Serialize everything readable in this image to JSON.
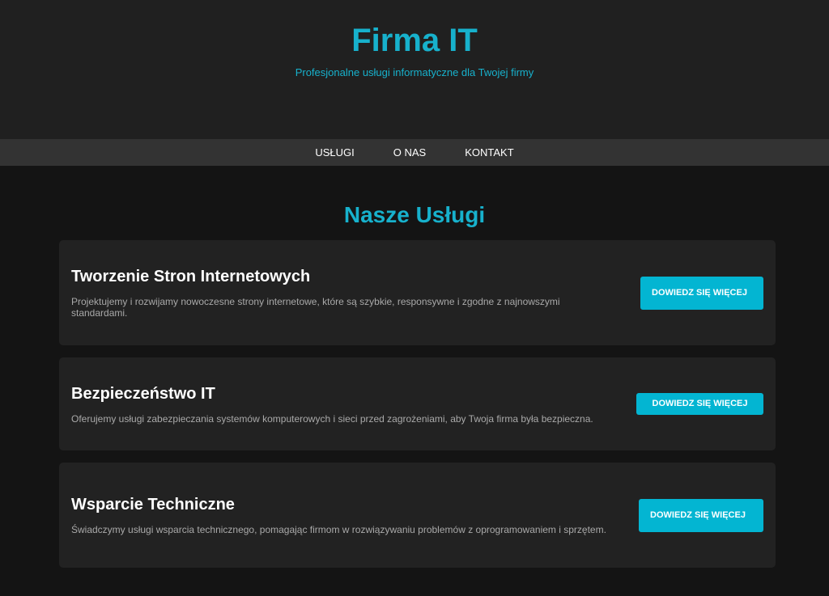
{
  "header": {
    "title": "Firma IT",
    "tagline": "Profesjonalne usługi informatyczne dla Twojej firmy"
  },
  "nav": {
    "items": [
      {
        "label": "USŁUGI"
      },
      {
        "label": "O NAS"
      },
      {
        "label": "KONTAKT"
      }
    ]
  },
  "services": {
    "title": "Nasze Usługi",
    "cards": [
      {
        "title": "Tworzenie Stron Internetowych",
        "description": "Projektujemy i rozwijamy nowoczesne strony internetowe, które są szybkie, responsywne i zgodne z najnowszymi standardami.",
        "button_label": "DOWIEDZ SIĘ WIĘCEJ"
      },
      {
        "title": "Bezpieczeństwo IT",
        "description": "Oferujemy usługi zabezpieczania systemów komputerowych i sieci przed zagrożeniami, aby Twoja firma była bezpieczna.",
        "button_label": "DOWIEDZ SIĘ WIĘCEJ"
      },
      {
        "title": "Wsparcie Techniczne",
        "description": "Świadczymy usługi wsparcia technicznego, pomagając firmom w rozwiązywaniu problemów z oprogramowaniem i sprzętem.",
        "button_label": "DOWIEDZ SIĘ WIĘCEJ"
      }
    ]
  },
  "colors": {
    "accent": "#17b1cc",
    "button": "#03b5d2",
    "background": "#141414",
    "card": "#222222",
    "nav": "#333333"
  }
}
